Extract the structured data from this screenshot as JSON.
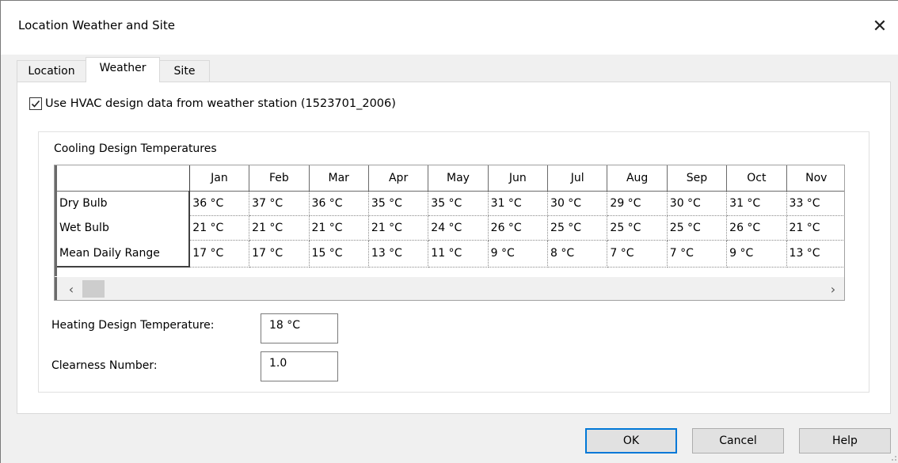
{
  "window": {
    "title": "Location Weather and Site",
    "close_glyph": "✕",
    "close_icon": "close-icon"
  },
  "tabs": [
    {
      "label": "Location",
      "active": false
    },
    {
      "label": "Weather",
      "active": true
    },
    {
      "label": "Site",
      "active": false
    }
  ],
  "weather": {
    "use_station_checkbox": {
      "checked": true,
      "label": "Use HVAC design data from weather station (1523701_2006)"
    },
    "cooling_group_label": "Cooling Design Temperatures",
    "grid": {
      "columns": [
        "Jan",
        "Feb",
        "Mar",
        "Apr",
        "May",
        "Jun",
        "Jul",
        "Aug",
        "Sep",
        "Oct",
        "Nov"
      ],
      "rows": [
        {
          "label": "Dry Bulb",
          "values": [
            "36 °C",
            "37 °C",
            "36 °C",
            "35 °C",
            "35 °C",
            "31 °C",
            "30 °C",
            "29 °C",
            "30 °C",
            "31 °C",
            "33 °C"
          ]
        },
        {
          "label": "Wet Bulb",
          "values": [
            "21 °C",
            "21 °C",
            "21 °C",
            "21 °C",
            "24 °C",
            "26 °C",
            "25 °C",
            "25 °C",
            "25 °C",
            "26 °C",
            "21 °C"
          ]
        },
        {
          "label": "Mean Daily Range",
          "values": [
            "17 °C",
            "17 °C",
            "15 °C",
            "13 °C",
            "11 °C",
            "9 °C",
            "8 °C",
            "7 °C",
            "7 °C",
            "9 °C",
            "13 °C"
          ]
        }
      ],
      "scroll_left_glyph": "‹",
      "scroll_right_glyph": "›"
    },
    "heating_label": "Heating Design Temperature:",
    "heating_value": "18 °C",
    "clearness_label": "Clearness Number:",
    "clearness_value": "1.0"
  },
  "buttons": {
    "ok": "OK",
    "cancel": "Cancel",
    "help": "Help"
  },
  "colors": {
    "dialog_bg": "#f0f0f0",
    "default_button_border": "#0078d7"
  }
}
